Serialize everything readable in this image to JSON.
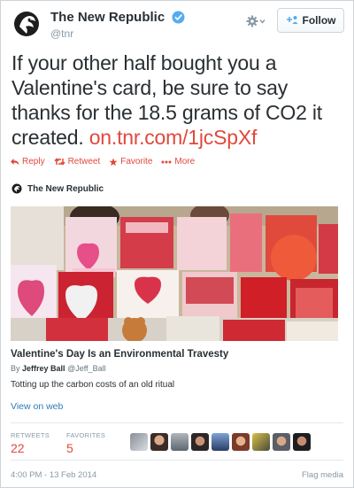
{
  "account": {
    "name": "The New Republic",
    "handle": "@tnr"
  },
  "follow_button": {
    "label": "Follow"
  },
  "tweet": {
    "text": "If your other half bought you a Valentine's card, be sure to say thanks for the 18.5 grams of CO2 it created.",
    "link": "on.tnr.com/1jcSpXf"
  },
  "actions": {
    "reply": "Reply",
    "retweet": "Retweet",
    "favorite": "Favorite",
    "more": "More"
  },
  "card": {
    "source": "The New Republic",
    "title": "Valentine's Day Is an Environmental Travesty",
    "byline_prefix": "By",
    "author": "Jeffrey Ball",
    "author_handle": "@Jeff_Ball",
    "description": "Totting up the carbon costs of an old ritual",
    "image_description": "Racks of red and pink Valentine's Day greeting cards",
    "view_on_web": "View on web"
  },
  "stats": {
    "retweets_label": "RETWEETS",
    "retweets_value": "22",
    "favorites_label": "FAVORITES",
    "favorites_value": "5"
  },
  "footer": {
    "timestamp": "4:00 PM - 13 Feb 2014",
    "flag": "Flag media"
  },
  "colors": {
    "accent": "#e0493c",
    "link_blue": "#2b7bb9",
    "verified_blue": "#55acee",
    "muted": "#8899a6"
  },
  "icons": [
    "avatar-logo",
    "verified-badge-icon",
    "gear-icon",
    "chevron-down-icon",
    "follow-user-plus-icon",
    "reply-icon",
    "retweet-icon",
    "star-icon",
    "more-dots-icon"
  ]
}
